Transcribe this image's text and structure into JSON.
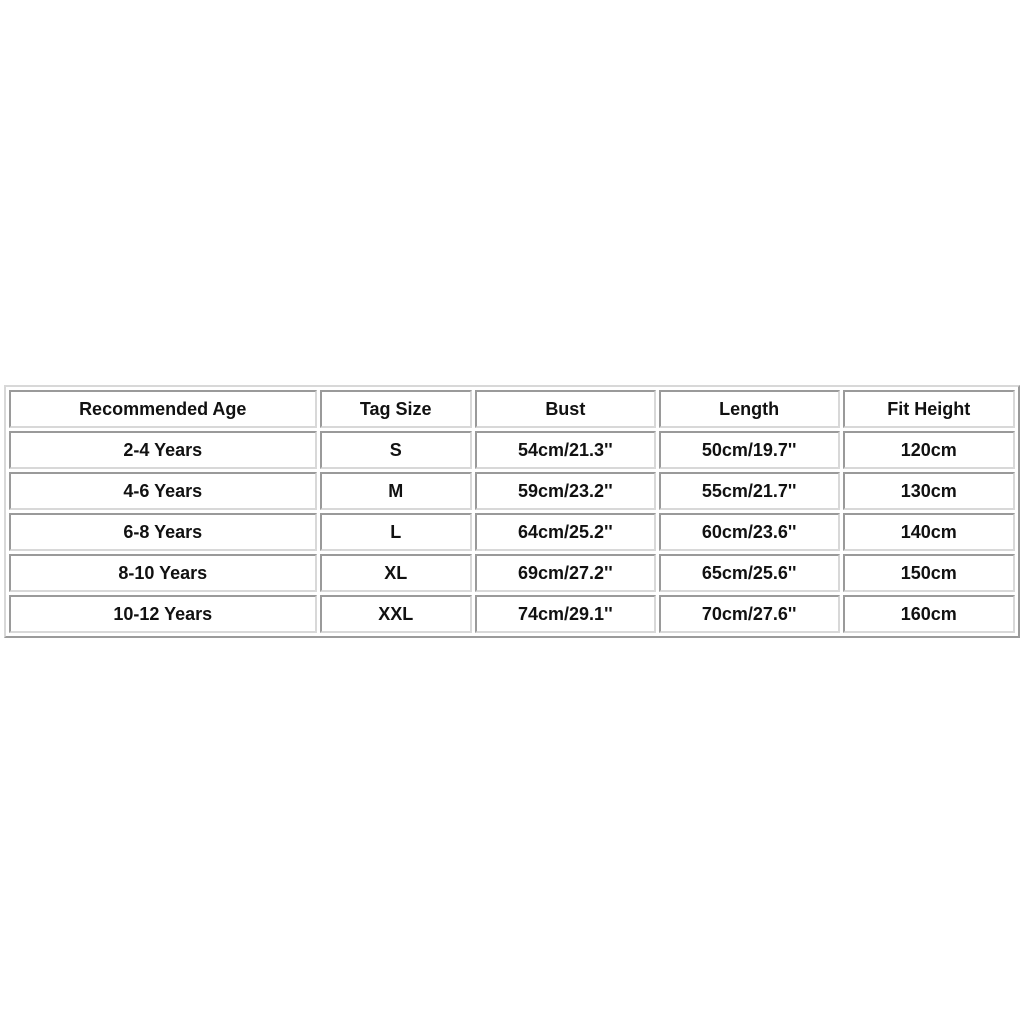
{
  "table": {
    "headers": [
      "Recommended Age",
      "Tag Size",
      "Bust",
      "Length",
      "Fit Height"
    ],
    "rows": [
      [
        "2-4 Years",
        "S",
        "54cm/21.3''",
        "50cm/19.7''",
        "120cm"
      ],
      [
        "4-6 Years",
        "M",
        "59cm/23.2''",
        "55cm/21.7''",
        "130cm"
      ],
      [
        "6-8 Years",
        "L",
        "64cm/25.2''",
        "60cm/23.6''",
        "140cm"
      ],
      [
        "8-10 Years",
        "XL",
        "69cm/27.2''",
        "65cm/25.6''",
        "150cm"
      ],
      [
        "10-12 Years",
        "XXL",
        "74cm/29.1''",
        "70cm/27.6''",
        "160cm"
      ]
    ]
  }
}
